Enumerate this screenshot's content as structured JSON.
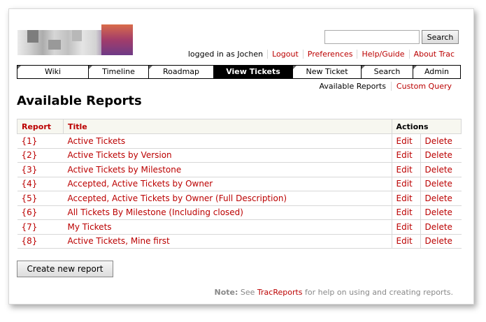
{
  "search": {
    "placeholder": "",
    "value": "",
    "button_label": "Search"
  },
  "metanav": {
    "logged_in": "logged in as Jochen",
    "items": [
      "Logout",
      "Preferences",
      "Help/Guide",
      "About Trac"
    ]
  },
  "mainnav": {
    "tabs": [
      "Wiki",
      "Timeline",
      "Roadmap",
      "View Tickets",
      "New Ticket",
      "Search",
      "Admin"
    ],
    "active": "View Tickets"
  },
  "ctxnav": {
    "current": "Available Reports",
    "link": "Custom Query"
  },
  "page": {
    "title": "Available Reports"
  },
  "table": {
    "headers": {
      "report": "Report",
      "title": "Title",
      "actions": "Actions"
    },
    "rows": [
      {
        "id": "{1}",
        "title": "Active Tickets",
        "edit": "Edit",
        "delete": "Delete"
      },
      {
        "id": "{2}",
        "title": "Active Tickets by Version",
        "edit": "Edit",
        "delete": "Delete"
      },
      {
        "id": "{3}",
        "title": "Active Tickets by Milestone",
        "edit": "Edit",
        "delete": "Delete"
      },
      {
        "id": "{4}",
        "title": "Accepted, Active Tickets by Owner",
        "edit": "Edit",
        "delete": "Delete"
      },
      {
        "id": "{5}",
        "title": "Accepted, Active Tickets by Owner (Full Description)",
        "edit": "Edit",
        "delete": "Delete"
      },
      {
        "id": "{6}",
        "title": "All Tickets By Milestone (Including closed)",
        "edit": "Edit",
        "delete": "Delete"
      },
      {
        "id": "{7}",
        "title": "My Tickets",
        "edit": "Edit",
        "delete": "Delete"
      },
      {
        "id": "{8}",
        "title": "Active Tickets, Mine first",
        "edit": "Edit",
        "delete": "Delete"
      }
    ]
  },
  "create_button": "Create new report",
  "note": {
    "label": "Note:",
    "pre": " See ",
    "link": "TracReports",
    "post": " for help on using and creating reports."
  },
  "colors": {
    "link": "#bb0000",
    "active_tab": "#000000",
    "header_bg": "#f7f7f0"
  }
}
